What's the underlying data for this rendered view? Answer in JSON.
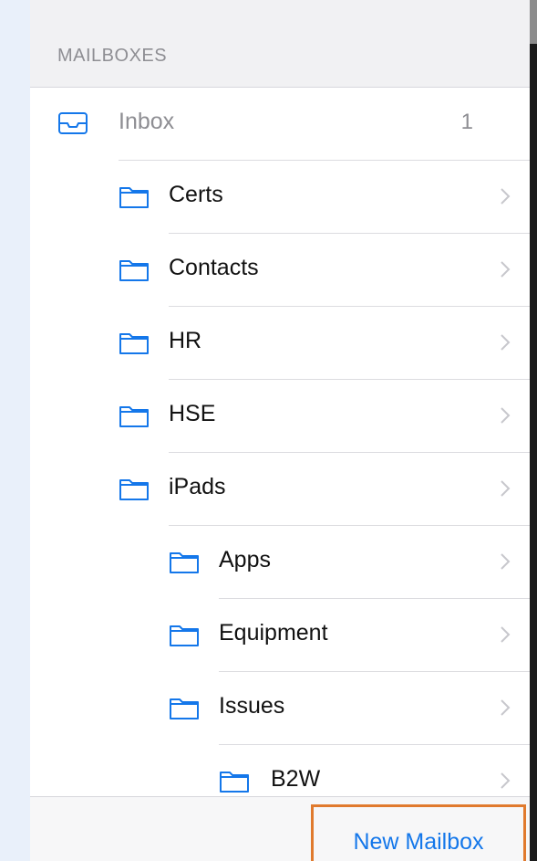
{
  "section_header": "MAILBOXES",
  "inbox": {
    "label": "Inbox",
    "count": "1"
  },
  "mailboxes": [
    {
      "label": "Certs"
    },
    {
      "label": "Contacts"
    },
    {
      "label": "HR"
    },
    {
      "label": "HSE"
    },
    {
      "label": "iPads"
    },
    {
      "label": "Apps"
    },
    {
      "label": "Equipment"
    },
    {
      "label": "Issues"
    },
    {
      "label": "B2W"
    }
  ],
  "footer": {
    "new_mailbox_label": "New Mailbox"
  },
  "colors": {
    "accent": "#1477ea",
    "highlight_border": "#e07a2e",
    "secondary_text": "#8e8e93"
  }
}
